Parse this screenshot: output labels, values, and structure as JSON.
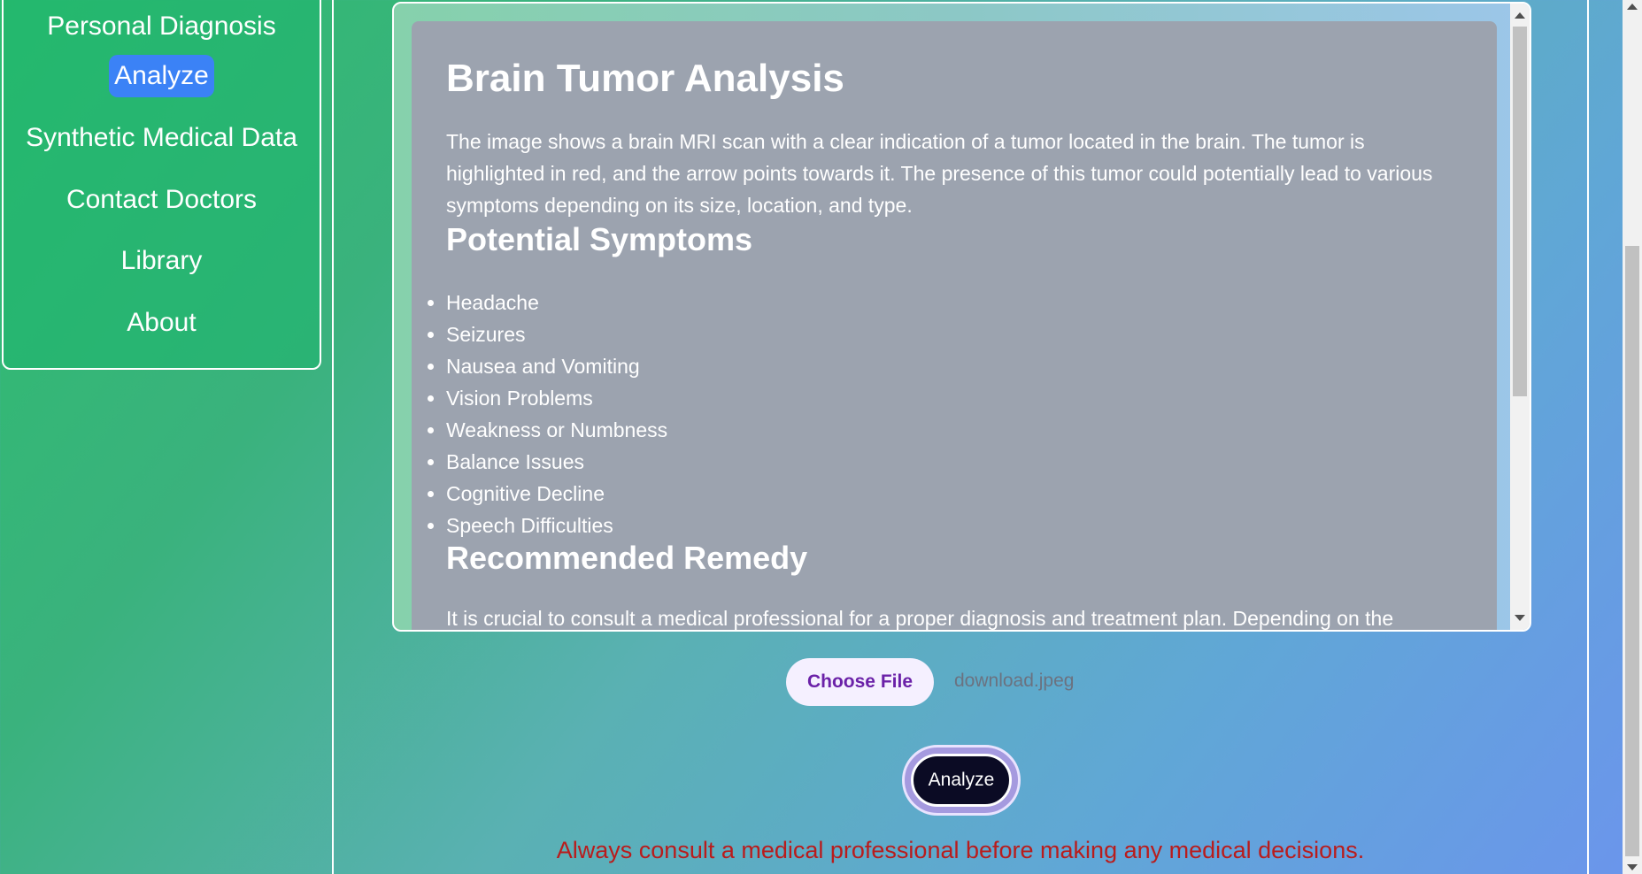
{
  "nav": {
    "items": [
      {
        "label": "Personal Diagnosis",
        "active": false
      },
      {
        "label": "Analyze",
        "active": true
      },
      {
        "label": "Synthetic Medical Data",
        "active": false
      },
      {
        "label": "Contact Doctors",
        "active": false
      },
      {
        "label": "Library",
        "active": false
      },
      {
        "label": "About",
        "active": false
      }
    ]
  },
  "result": {
    "title": "Brain Tumor Analysis",
    "intro": "The image shows a brain MRI scan with a clear indication of a tumor located in the brain. The tumor is highlighted in red, and the arrow points towards it. The presence of this tumor could potentially lead to various symptoms depending on its size, location, and type.",
    "symptoms_heading": "Potential Symptoms",
    "symptoms": [
      "Headache",
      "Seizures",
      "Nausea and Vomiting",
      "Vision Problems",
      "Weakness or Numbness",
      "Balance Issues",
      "Cognitive Decline",
      "Speech Difficulties"
    ],
    "remedy_heading": "Recommended Remedy",
    "remedy_text": "It is crucial to consult a medical professional for a proper diagnosis and treatment plan. Depending on the"
  },
  "upload": {
    "choose_label": "Choose File",
    "file_name": "download.jpeg"
  },
  "analyze_label": "Analyze",
  "disclaimer": "Always consult a medical professional before making any medical decisions.",
  "colors": {
    "active_nav": "#3b82f6",
    "disclaimer": "#b91c1c",
    "choose_text": "#6b21a8"
  }
}
